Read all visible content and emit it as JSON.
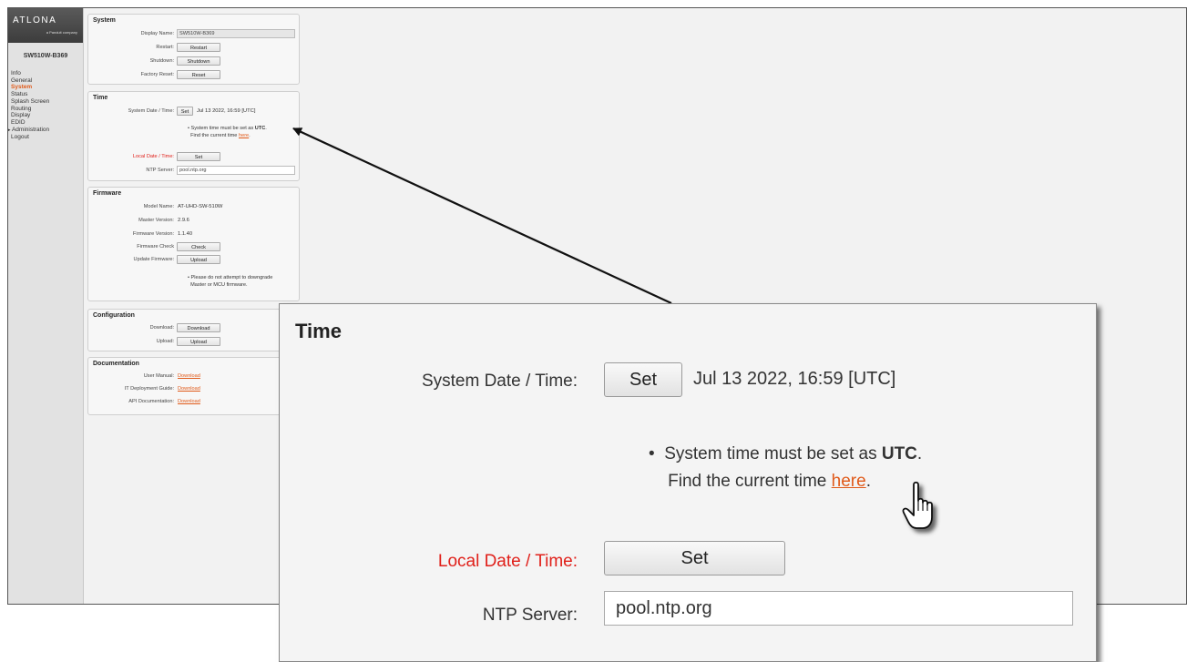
{
  "app": {
    "logo_text": "ATLONA",
    "logo_subtext": "a Panduit company",
    "device_name": "SW510W-B369"
  },
  "nav": {
    "items": [
      {
        "label": "Info",
        "active": false
      },
      {
        "label": "General",
        "active": false
      },
      {
        "label": "System",
        "active": true
      },
      {
        "label": "Status",
        "active": false
      },
      {
        "label": "Splash Screen",
        "active": false
      },
      {
        "label": "Routing",
        "active": false
      },
      {
        "label": "Display",
        "active": false
      },
      {
        "label": "EDID",
        "active": false
      },
      {
        "label": "Administration",
        "active": false,
        "expandable": true
      },
      {
        "label": "Logout",
        "active": false
      }
    ]
  },
  "system": {
    "title": "System",
    "display_name_label": "Display Name:",
    "display_name_value": "SW510W-B369",
    "restart_label": "Restart:",
    "restart_button": "Restart",
    "shutdown_label": "Shutdown:",
    "shutdown_button": "Shutdown",
    "factory_reset_label": "Factory Reset:",
    "reset_button": "Reset"
  },
  "time": {
    "title": "Time",
    "system_date_label": "System Date / Time:",
    "set_button": "Set",
    "system_date_value": "Jul 13 2022, 16:59 [UTC]",
    "note_line1_prefix": "System time must be set as ",
    "note_line1_bold": "UTC",
    "note_line1_suffix": ".",
    "note_line2_prefix": "Find the current time ",
    "note_line2_link": "here",
    "note_line2_suffix": ".",
    "local_date_label": "Local Date / Time:",
    "local_set_button": "Set",
    "ntp_label": "NTP Server:",
    "ntp_value": "pool.ntp.org"
  },
  "firmware": {
    "title": "Firmware",
    "model_label": "Model Name:",
    "model_value": "AT-UHD-SW-510W",
    "master_label": "Master Version:",
    "master_value": "2.9.6",
    "fw_label": "Firmware Version:",
    "fw_value": "1.1.40",
    "check_label": "Firmware Check",
    "check_button": "Check",
    "update_label": "Update Firmware:",
    "upload_button": "Upload",
    "note_line1": "Please do not attempt to downgrade",
    "note_line2": "Master or MCU firmware."
  },
  "configuration": {
    "title": "Configuration",
    "download_label": "Download:",
    "download_button": "Download",
    "upload_label": "Upload:",
    "upload_button": "Upload"
  },
  "documentation": {
    "title": "Documentation",
    "user_manual_label": "User Manual:",
    "user_manual_link": "Download",
    "it_guide_label": "IT Deployment Guide:",
    "it_guide_link": "Download",
    "api_label": "API Documentation:",
    "api_link": "Download"
  },
  "colors": {
    "accent": "#e05a1a",
    "required_label": "#e0201a",
    "sidebar_bg": "#e2e2e2",
    "content_bg": "#f2f2f2"
  }
}
